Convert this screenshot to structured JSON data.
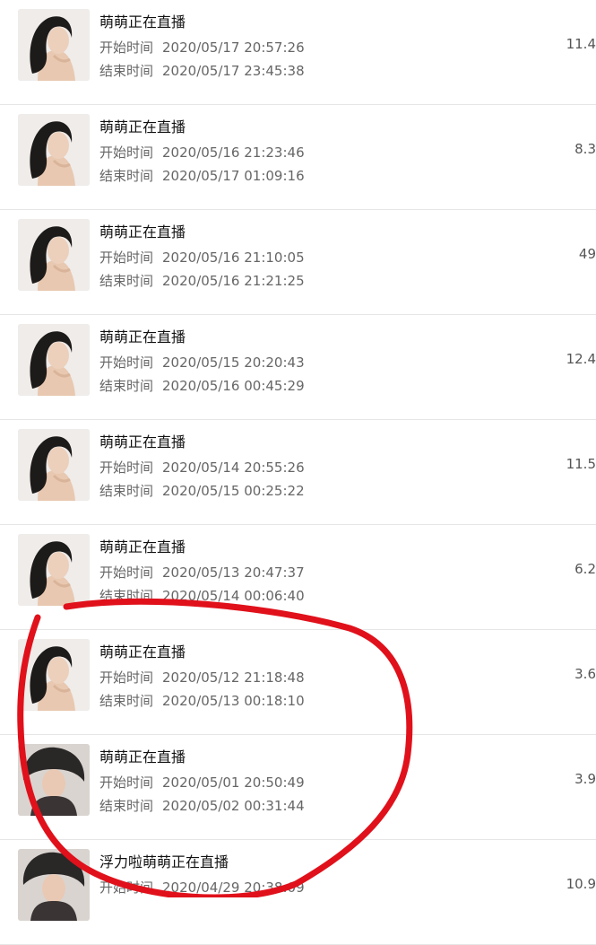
{
  "broadcasts": [
    {
      "title": "萌萌正在直播",
      "start_label": "开始时间",
      "start_time": "2020/05/17 20:57:26",
      "end_label": "结束时间",
      "end_time": "2020/05/17 23:45:38",
      "stat": "11.4",
      "avatar": "avatar-a"
    },
    {
      "title": "萌萌正在直播",
      "start_label": "开始时间",
      "start_time": "2020/05/16 21:23:46",
      "end_label": "结束时间",
      "end_time": "2020/05/17 01:09:16",
      "stat": "8.3",
      "avatar": "avatar-a"
    },
    {
      "title": "萌萌正在直播",
      "start_label": "开始时间",
      "start_time": "2020/05/16 21:10:05",
      "end_label": "结束时间",
      "end_time": "2020/05/16 21:21:25",
      "stat": "49",
      "avatar": "avatar-a"
    },
    {
      "title": "萌萌正在直播",
      "start_label": "开始时间",
      "start_time": "2020/05/15 20:20:43",
      "end_label": "结束时间",
      "end_time": "2020/05/16 00:45:29",
      "stat": "12.4",
      "avatar": "avatar-a"
    },
    {
      "title": "萌萌正在直播",
      "start_label": "开始时间",
      "start_time": "2020/05/14 20:55:26",
      "end_label": "结束时间",
      "end_time": "2020/05/15 00:25:22",
      "stat": "11.5",
      "avatar": "avatar-a"
    },
    {
      "title": "萌萌正在直播",
      "start_label": "开始时间",
      "start_time": "2020/05/13 20:47:37",
      "end_label": "结束时间",
      "end_time": "2020/05/14 00:06:40",
      "stat": "6.2",
      "avatar": "avatar-a"
    },
    {
      "title": "萌萌正在直播",
      "start_label": "开始时间",
      "start_time": "2020/05/12 21:18:48",
      "end_label": "结束时间",
      "end_time": "2020/05/13 00:18:10",
      "stat": "3.6",
      "avatar": "avatar-a"
    },
    {
      "title": "萌萌正在直播",
      "start_label": "开始时间",
      "start_time": "2020/05/01 20:50:49",
      "end_label": "结束时间",
      "end_time": "2020/05/02 00:31:44",
      "stat": "3.9",
      "avatar": "avatar-b"
    },
    {
      "title": "浮力啦萌萌正在直播",
      "start_label": "开始时间",
      "start_time": "2020/04/29 20:38:09",
      "end_label": "",
      "end_time": "",
      "stat": "10.9",
      "avatar": "avatar-b"
    }
  ],
  "colors": {
    "annotation": "#e0111b",
    "divider": "#e6e6e6"
  }
}
